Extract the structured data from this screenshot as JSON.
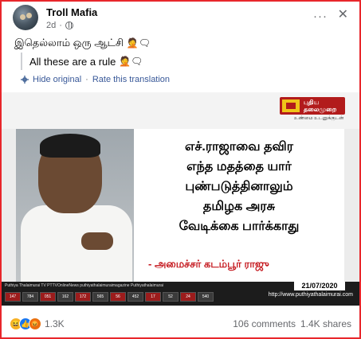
{
  "post": {
    "author": "Troll Mafia",
    "time": "2d",
    "more_label": "···",
    "close_label": "✕",
    "original_text": "இதெல்லாம் ஒரு ஆட்சி",
    "translated_text": "All these are a rule",
    "hide_original": "Hide original",
    "rate_translation": "Rate this translation",
    "separator": "·"
  },
  "image": {
    "channel_name_line1": "புதிய",
    "channel_name_line2": "தலைமுறை",
    "channel_tagline": "உண்மை உடனுக்குடன்",
    "quote_lines": [
      "எச்.ராஜாவை தவிர",
      "எந்த மதத்தை யார்",
      "புண்படுத்தினாலும்",
      "தமிழக அரசு",
      "வேடிக்கை பார்க்காது"
    ],
    "attribution": "- அமைச்சர் கடம்பூர் ராஜு",
    "date": "21/07/2020",
    "url": "http://www.puthiyathalaimurai.com",
    "social_handles": "Puthiya Thalaimurai TV   PTTVOnlineNews   puthiyathalaimuraimagazine   Puthiyathalaimurai",
    "ticker_cells": [
      "147",
      "784",
      "051",
      "162",
      "172",
      "565",
      "56",
      "452",
      "17",
      "52",
      "24",
      "540"
    ]
  },
  "stats": {
    "reaction_count": "1.3K",
    "comments": "106 comments",
    "shares": "1.4K shares"
  },
  "icons": {
    "globe": "globe-icon",
    "gear": "gear-icon",
    "haha": "haha-reaction-icon",
    "like": "like-reaction-icon",
    "angry": "angry-reaction-icon"
  },
  "colors": {
    "border": "#e8262b",
    "link": "#385898",
    "attribution": "#c4161c"
  }
}
